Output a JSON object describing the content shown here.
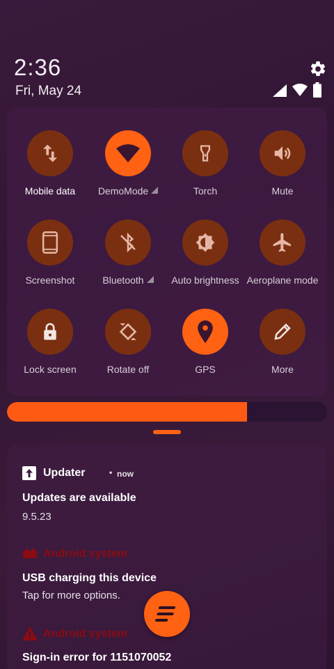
{
  "status_bar": {
    "time": "2:36",
    "date": "Fri, May 24"
  },
  "quick_settings": {
    "tiles": [
      {
        "label": "Mobile data",
        "icon": "swap-vert-icon",
        "active": false
      },
      {
        "label": "DemoMode",
        "icon": "wifi-icon",
        "active": true
      },
      {
        "label": "Torch",
        "icon": "flashlight-icon",
        "active": false
      },
      {
        "label": "Mute",
        "icon": "volume-icon",
        "active": false
      },
      {
        "label": "Screenshot",
        "icon": "phone-icon",
        "active": false
      },
      {
        "label": "Bluetooth",
        "icon": "bluetooth-off-icon",
        "active": false
      },
      {
        "label": "Auto brightness",
        "icon": "brightness-auto-icon",
        "active": false
      },
      {
        "label": "Aeroplane mode",
        "icon": "airplane-icon",
        "active": false
      },
      {
        "label": "Lock screen",
        "icon": "lock-icon",
        "active": false
      },
      {
        "label": "Rotate off",
        "icon": "rotate-icon",
        "active": false
      },
      {
        "label": "GPS",
        "icon": "location-pin-icon",
        "active": true
      },
      {
        "label": "More",
        "icon": "pencil-icon",
        "active": false
      }
    ],
    "brightness_level": 0.75
  },
  "notifications": [
    {
      "app": "Updater",
      "time": "now",
      "title": "Updates are available",
      "text": "9.5.23",
      "icon": "updater-icon"
    },
    {
      "app": "Android system",
      "title": "USB charging this device",
      "text": "Tap for more options.",
      "icon": "android-system-icon"
    },
    {
      "app": "Android system",
      "title": "Sign-in error for 1151070052",
      "icon": "warning-icon"
    }
  ],
  "colors": {
    "accent": "#ff6212",
    "tile_inactive": "#7a3010",
    "system_red": "#8a0c12"
  }
}
